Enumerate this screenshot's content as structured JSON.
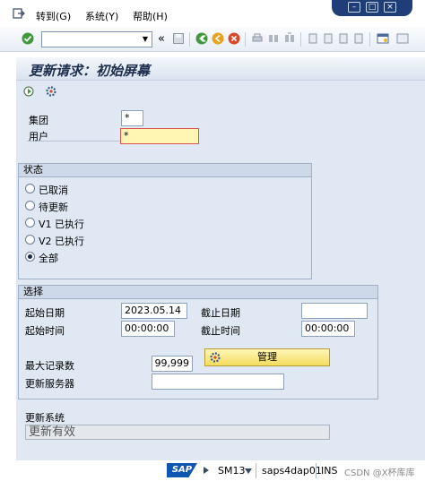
{
  "menubar": {
    "items": [
      {
        "label": "转到(G)"
      },
      {
        "label": "系统(Y)"
      },
      {
        "label": "帮助(H)"
      }
    ]
  },
  "toolbar": {
    "command_value": "",
    "back_symbol": "«"
  },
  "screen": {
    "title": "更新请求：初始屏幕"
  },
  "selection": {
    "client_label": "集团",
    "client_value": "*",
    "user_label": "用户",
    "user_value": "*"
  },
  "status_group": {
    "title": "状态",
    "options": [
      {
        "label": "已取消",
        "selected": false
      },
      {
        "label": "待更新",
        "selected": false
      },
      {
        "label": "V1 已执行",
        "selected": false
      },
      {
        "label": "V2 已执行",
        "selected": false
      },
      {
        "label": "全部",
        "selected": true
      }
    ]
  },
  "select_group": {
    "title": "选择",
    "start_date_label": "起始日期",
    "start_date_value": "2023.05.14",
    "end_date_label": "截止日期",
    "end_date_value": "",
    "start_time_label": "起始时间",
    "start_time_value": "00:00:00",
    "end_time_label": "截止时间",
    "end_time_value": "00:00:00",
    "max_records_label": "最大记录数",
    "max_records_value": "99,999",
    "update_server_label": "更新服务器",
    "update_server_value": ""
  },
  "update_system": {
    "label": "更新系统",
    "manage_button": "管理",
    "status_value": "更新有效"
  },
  "statusbar": {
    "logo": "SAP",
    "transaction": "SM13",
    "server": "saps4dap01",
    "mode": "INS",
    "watermark": "CSDN @X杯库库"
  },
  "colors": {
    "accent_blue": "#1f3e78",
    "button_yellow": "#f4dc5c",
    "screen_bg": "#dfe8f3",
    "required_border": "#d9534f"
  }
}
